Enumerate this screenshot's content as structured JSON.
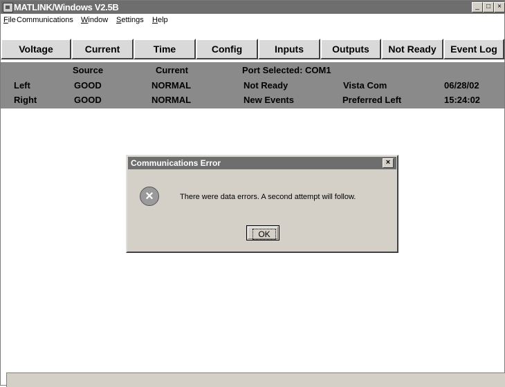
{
  "window": {
    "title": "MATLINK/Windows V2.5B",
    "controls": {
      "minimize": "_",
      "maximize": "□",
      "close": "×"
    }
  },
  "menu": {
    "items": [
      {
        "key": "F",
        "rest": "ile"
      },
      {
        "key": "",
        "rest": "Communications"
      },
      {
        "key": "W",
        "rest": "indow"
      },
      {
        "key": "S",
        "rest": "ettings"
      },
      {
        "key": "H",
        "rest": "elp"
      }
    ]
  },
  "toolbar": {
    "buttons": [
      "Voltage",
      "Current",
      "Time",
      "Config",
      "Inputs",
      "Outputs",
      "Not Ready",
      "Event Log"
    ]
  },
  "status": {
    "headers": {
      "source": "Source",
      "current": "Current",
      "port": "Port Selected: COM1"
    },
    "rows": [
      {
        "label": "Left",
        "source": "GOOD",
        "current": "NORMAL",
        "state": "Not Ready",
        "info": "Vista Com",
        "value": "06/28/02"
      },
      {
        "label": "Right",
        "source": "GOOD",
        "current": "NORMAL",
        "state": "New Events",
        "info": "Preferred Left",
        "value": "15:24:02"
      }
    ]
  },
  "dialog": {
    "title": "Communications Error",
    "close": "×",
    "icon": "error-icon",
    "icon_glyph": "×",
    "message": "There were data errors.  A second attempt will follow.",
    "ok_label": "OK"
  },
  "colors": {
    "titlebar": "#6e6e6e",
    "status_panel": "#8a8a8a",
    "button_face": "#d9d9d9"
  }
}
